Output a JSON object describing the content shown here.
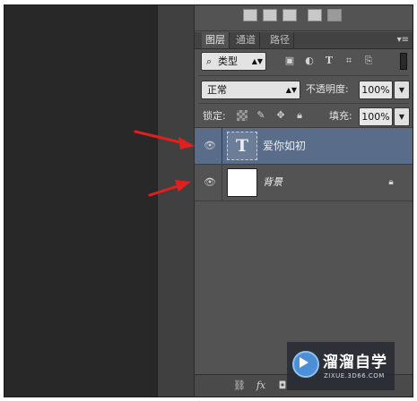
{
  "tabs": [
    {
      "label": "图层",
      "active": true
    },
    {
      "label": "通道",
      "active": false
    },
    {
      "label": "路径",
      "active": false
    }
  ],
  "panel_menu_icon": "panel-menu-icon",
  "filter": {
    "label": "类型",
    "icons": [
      "image-filter-icon",
      "adjustment-filter-icon",
      "type-filter-icon",
      "shape-filter-icon",
      "smart-object-filter-icon"
    ],
    "type_glyph": "T"
  },
  "blend": {
    "mode": "正常",
    "opacity_label": "不透明度:",
    "opacity_value": "100%"
  },
  "lock": {
    "label": "锁定:",
    "fill_label": "填充:",
    "fill_value": "100%",
    "icons": [
      "lock-transparent-pixels-icon",
      "lock-image-pixels-icon",
      "lock-position-icon",
      "lock-all-icon"
    ]
  },
  "layers": [
    {
      "name": "爱你如初",
      "type": "text",
      "thumb_glyph": "T",
      "selected": true,
      "locked": false
    },
    {
      "name": "背景",
      "type": "background",
      "thumb_glyph": "",
      "selected": false,
      "locked": true
    }
  ],
  "bottom_bar": {
    "fx_label": "fx",
    "icons": [
      "link-layers-icon",
      "layer-style-icon",
      "add-mask-icon"
    ]
  },
  "watermark": {
    "title": "溜溜自学",
    "subtitle": "ZIXUE.3D66.COM"
  },
  "colors": {
    "panel_bg": "#535353",
    "selected_layer": "#596d8b",
    "annotation_arrow": "#e0201f",
    "watermark_blue": "#4d8fd6"
  }
}
